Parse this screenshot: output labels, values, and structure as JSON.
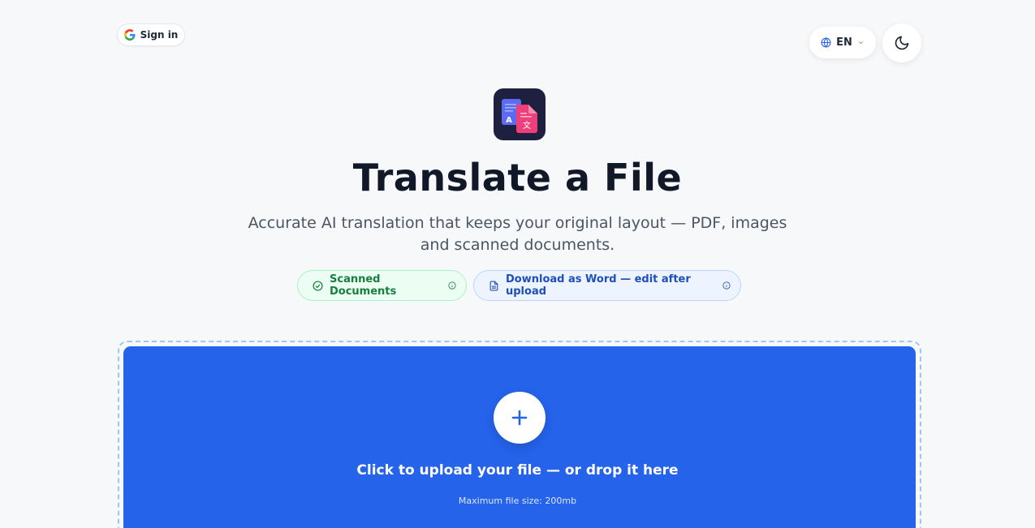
{
  "header": {
    "signin_label": "Sign in",
    "language": "EN"
  },
  "hero": {
    "title": "Translate a File",
    "subtitle": "Accurate AI translation that keeps your original layout — PDF, images and scanned documents."
  },
  "badges": {
    "scanned": "Scanned Documents",
    "word": "Download as Word — edit after upload"
  },
  "upload": {
    "cta": "Click to upload your file — or drop it here",
    "note": "Maximum file size: 200mb"
  },
  "icons": {
    "signin": "google-icon",
    "language": "globe-icon",
    "theme": "moon-icon",
    "upload": "plus-icon"
  },
  "colors": {
    "accent": "#2563eb",
    "success": "#15803d"
  }
}
